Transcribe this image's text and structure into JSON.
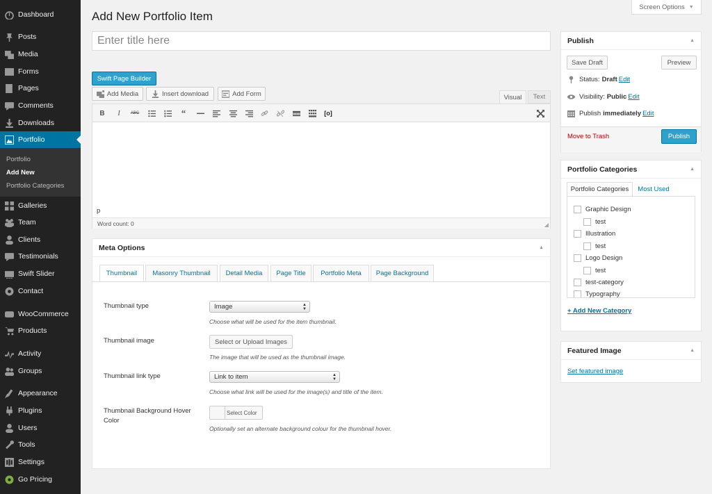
{
  "sidebar": {
    "items": [
      {
        "label": "Dashboard",
        "icon": "dashboard-icon"
      },
      {
        "label": "Posts",
        "icon": "pin-icon"
      },
      {
        "label": "Media",
        "icon": "media-icon"
      },
      {
        "label": "Forms",
        "icon": "forms-icon"
      },
      {
        "label": "Pages",
        "icon": "pages-icon"
      },
      {
        "label": "Comments",
        "icon": "comments-icon"
      },
      {
        "label": "Downloads",
        "icon": "downloads-icon"
      },
      {
        "label": "Portfolio",
        "icon": "portfolio-icon"
      },
      {
        "label": "Galleries",
        "icon": "galleries-icon"
      },
      {
        "label": "Team",
        "icon": "team-icon"
      },
      {
        "label": "Clients",
        "icon": "clients-icon"
      },
      {
        "label": "Testimonials",
        "icon": "testimonials-icon"
      },
      {
        "label": "Swift Slider",
        "icon": "slider-icon"
      },
      {
        "label": "Contact",
        "icon": "contact-icon"
      },
      {
        "label": "WooCommerce",
        "icon": "woocommerce-icon"
      },
      {
        "label": "Products",
        "icon": "products-icon"
      },
      {
        "label": "Activity",
        "icon": "activity-icon"
      },
      {
        "label": "Groups",
        "icon": "groups-icon"
      },
      {
        "label": "Appearance",
        "icon": "appearance-icon"
      },
      {
        "label": "Plugins",
        "icon": "plugins-icon"
      },
      {
        "label": "Users",
        "icon": "users-icon"
      },
      {
        "label": "Tools",
        "icon": "tools-icon"
      },
      {
        "label": "Settings",
        "icon": "settings-icon"
      },
      {
        "label": "Go Pricing",
        "icon": "go-pricing-icon"
      }
    ],
    "submenu": [
      "Portfolio",
      "Add New",
      "Portfolio Categories"
    ]
  },
  "header": {
    "title": "Add New Portfolio Item",
    "screen_options": "Screen Options"
  },
  "title_field": {
    "placeholder": "Enter title here"
  },
  "editor": {
    "page_builder": "Swift Page Builder",
    "add_media": "Add Media",
    "insert_download": "Insert download",
    "add_form": "Add Form",
    "tab_visual": "Visual",
    "tab_text": "Text",
    "path": "p",
    "word_count": "Word count: 0"
  },
  "meta": {
    "title": "Meta Options",
    "tabs": [
      "Thumbnail",
      "Masonry Thumbnail",
      "Detail Media",
      "Page Title",
      "Portfolio Meta",
      "Page Background"
    ],
    "thumb_type_label": "Thumbnail type",
    "thumb_type_value": "Image",
    "thumb_type_desc": "Choose what will be used for the item thumbnail.",
    "thumb_image_label": "Thumbnail image",
    "thumb_image_button": "Select or Upload Images",
    "thumb_image_desc": "The image that will be used as the thumbnail image.",
    "link_type_label": "Thumbnail link type",
    "link_type_value": "Link to item",
    "link_type_desc": "Choose what link will be used for the image(s) and title of the item.",
    "hover_label": "Thumbnail Background Hover Color",
    "hover_button": "Select Color",
    "hover_desc": "Optionally set an alternate background colour for the thumbnail hover."
  },
  "publish": {
    "title": "Publish",
    "save_draft": "Save Draft",
    "preview": "Preview",
    "status_label": "Status:",
    "status_value": "Draft",
    "visibility_label": "Visibility:",
    "visibility_value": "Public",
    "publish_label": "Publish",
    "publish_value": "immediately",
    "edit": "Edit",
    "trash": "Move to Trash",
    "publish_button": "Publish"
  },
  "categories": {
    "title": "Portfolio Categories",
    "tab_all": "Portfolio Categories",
    "tab_used": "Most Used",
    "items": [
      {
        "label": "Graphic Design",
        "level": 0
      },
      {
        "label": "test",
        "level": 1
      },
      {
        "label": "Illustration",
        "level": 0
      },
      {
        "label": "test",
        "level": 1
      },
      {
        "label": "Logo Design",
        "level": 0
      },
      {
        "label": "test",
        "level": 1
      },
      {
        "label": "test-category",
        "level": 0
      },
      {
        "label": "Typography",
        "level": 0
      }
    ],
    "add_new": "+ Add New Category"
  },
  "featured": {
    "title": "Featured Image",
    "set_link": "Set featured image"
  },
  "colors": {
    "accent": "#0074a2",
    "button": "#2ea2cc",
    "sidebar": "#222222",
    "trash": "#a00000"
  }
}
